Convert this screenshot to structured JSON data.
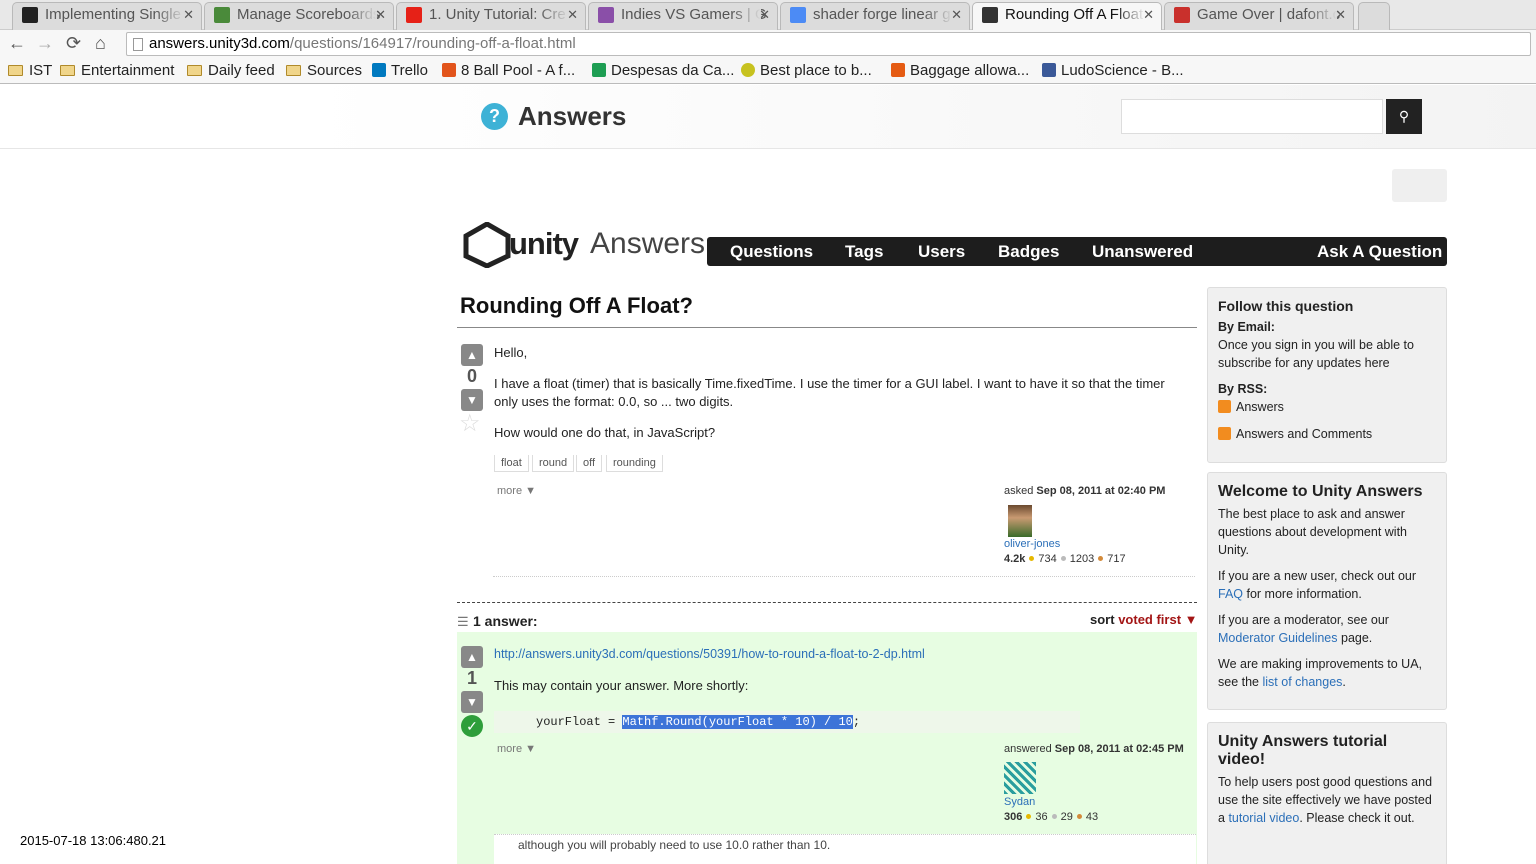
{
  "browser": {
    "tabs": [
      {
        "title": "Implementing Single",
        "favicon_color": "#222222"
      },
      {
        "title": "Manage Scoreboards",
        "favicon_color": "#4a8a3a"
      },
      {
        "title": "1. Unity Tutorial: Cre",
        "favicon_color": "#e62117"
      },
      {
        "title": "Indies VS Gamers | G",
        "favicon_color": "#8a4fa8"
      },
      {
        "title": "shader forge linear g",
        "favicon_color": "#4c8bf5"
      },
      {
        "title": "Rounding Off A Float",
        "favicon_color": "#333333"
      },
      {
        "title": "Game Over | dafont.c",
        "favicon_color": "#c9302c"
      }
    ],
    "active_tab": 5,
    "url_host": "answers.unity3d.com",
    "url_path": "/questions/164917/rounding-off-a-float.html",
    "bookmarks": [
      "IST",
      "Entertainment",
      "Daily feed",
      "Sources",
      "Trello",
      "8 Ball Pool - A f...",
      "Despesas da Ca...",
      "Best place to b...",
      "Baggage allowa...",
      "LudoScience - B..."
    ]
  },
  "site": {
    "title": "Answers",
    "logo_text_bold": "unity",
    "logo_text_light": "Answers",
    "nav": [
      "Questions",
      "Tags",
      "Users",
      "Badges",
      "Unanswered"
    ],
    "ask": "Ask A Question"
  },
  "question": {
    "title": "Rounding Off A Float?",
    "votes": "0",
    "paragraphs": [
      "Hello,",
      "I have a float (timer) that is basically Time.fixedTime. I use the timer for a GUI label. I want to have it so that the timer only uses the format: 0.0, so ... two digits.",
      "How would one do that, in JavaScript?"
    ],
    "tags": [
      "float",
      "round",
      "off",
      "rounding"
    ],
    "more": "more ▼",
    "asked_label": "asked",
    "asked_date": "Sep 08, 2011 at 02:40 PM",
    "user": "oliver-jones",
    "rep": "4.2k",
    "gold": "734",
    "silver": "1203",
    "bronze": "717"
  },
  "answers_header": {
    "count": "1 answer:",
    "sort_label": "sort",
    "sort_value": "voted first ▼"
  },
  "answer": {
    "votes": "1",
    "link": "http://answers.unity3d.com/questions/50391/how-to-round-a-float-to-2-dp.html",
    "text": "This may contain your answer. More shortly:",
    "code_prefix": "yourFloat = ",
    "code_selected": "Mathf.Round(yourFloat * 10) / 10",
    "code_suffix": ";",
    "more": "more ▼",
    "answered_label": "answered",
    "answered_date": "Sep 08, 2011 at 02:45 PM",
    "user": "Sydan",
    "rep": "306",
    "gold": "36",
    "silver": "29",
    "bronze": "43",
    "comment": "although you will probably need to use 10.0 rather than 10."
  },
  "sidebar": {
    "follow": {
      "title": "Follow this question",
      "email_label": "By Email:",
      "email_text": "Once you sign in you will be able to subscribe for any updates here",
      "rss_label": "By RSS:",
      "rss_answers": "Answers",
      "rss_answers_comments": "Answers and Comments"
    },
    "welcome": {
      "title": "Welcome to Unity Answers",
      "p1": "The best place to ask and answer questions about development with Unity.",
      "p2_before": "If you are a new user, check out our",
      "p2_link": "FAQ",
      "p2_after": "for more information.",
      "p3_before": "If you are a moderator, see our",
      "p3_link": "Moderator Guidelines",
      "p3_after": "page.",
      "p4_before": "We are making improvements to UA, see the",
      "p4_link": "list of changes",
      "p4_after": "."
    },
    "tutorial": {
      "title": "Unity Answers tutorial video!",
      "p_before": "To help users post good questions and use the site effectively we have posted a",
      "p_link": "tutorial video",
      "p_after": ". Please check it out."
    }
  },
  "overlay_timestamp": "2015-07-18 13:06:480.21",
  "colors": {
    "accent": "#3eb2d6",
    "nav_bg": "#1d1d1d",
    "answer_bg": "#e7fde2",
    "link": "#2b6fb8",
    "sort_red": "#a31515"
  }
}
